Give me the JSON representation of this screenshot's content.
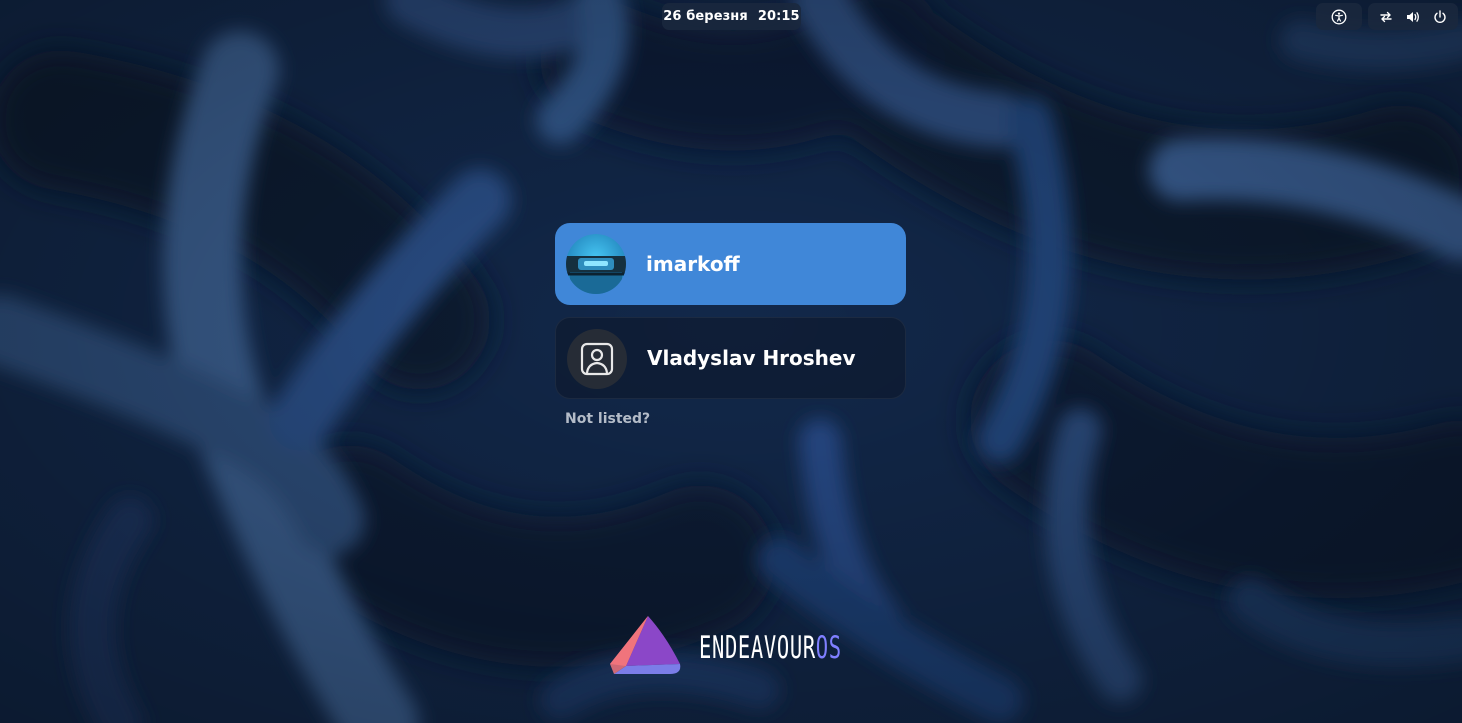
{
  "topbar": {
    "date": "26 березня",
    "time": "20:15",
    "icons": [
      "accessibility-icon",
      "network-wired-icon",
      "volume-icon",
      "power-icon"
    ]
  },
  "users": [
    {
      "name": "imarkoff",
      "avatar": "custom-avatar-photo",
      "selected": true
    },
    {
      "name": "Vladyslav Hroshev",
      "avatar": "default-user-avatar-icon",
      "selected": false
    }
  ],
  "not_listed_label": "Not listed?",
  "logo": {
    "word_main": "ENDEAVOUR",
    "word_accent": "OS"
  },
  "colors": {
    "selected_row": "#4087d8",
    "logo_accent": "#7f7fff",
    "background": "#0f2240"
  }
}
